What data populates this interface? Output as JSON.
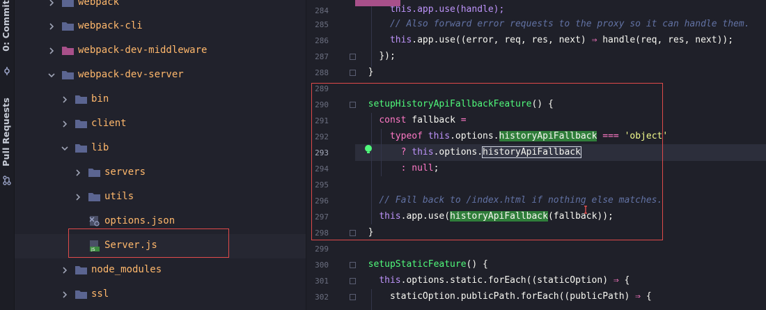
{
  "left_strip": {
    "commit_tab": "0: Commit",
    "pull_requests_tab": "Pull Requests"
  },
  "tree": {
    "items": [
      {
        "label": "webpack",
        "kind": "folder",
        "expanded": false,
        "color": "#ffb86c"
      },
      {
        "label": "webpack-cli",
        "kind": "folder",
        "expanded": false,
        "color": "#ffb86c"
      },
      {
        "label": "webpack-dev-middleware",
        "kind": "folder",
        "expanded": false,
        "color": "#ffb86c"
      },
      {
        "label": "webpack-dev-server",
        "kind": "folder",
        "expanded": true,
        "color": "#ffb86c"
      },
      {
        "label": "bin",
        "kind": "folder",
        "expanded": false,
        "color": "#ffb86c"
      },
      {
        "label": "client",
        "kind": "folder",
        "expanded": false,
        "color": "#ffb86c"
      },
      {
        "label": "lib",
        "kind": "folder",
        "expanded": true,
        "color": "#ffb86c"
      },
      {
        "label": "servers",
        "kind": "folder",
        "expanded": false,
        "color": "#ffb86c"
      },
      {
        "label": "utils",
        "kind": "folder",
        "expanded": false,
        "color": "#ffb86c"
      },
      {
        "label": "options.json",
        "kind": "json-file",
        "color": "#ffb86c"
      },
      {
        "label": "Server.js",
        "kind": "js-file",
        "selected": true,
        "color": "#ffb86c"
      },
      {
        "label": "node_modules",
        "kind": "folder",
        "expanded": false,
        "color": "#ffb86c"
      },
      {
        "label": "ssl",
        "kind": "folder",
        "expanded": false,
        "color": "#ffb86c"
      }
    ]
  },
  "editor": {
    "line_numbers": [
      "284",
      "285",
      "286",
      "287",
      "288",
      "289",
      "290",
      "291",
      "292",
      "293",
      "294",
      "295",
      "296",
      "297",
      "298",
      "299",
      "300",
      "301",
      "302"
    ],
    "current_line": "293",
    "lines": {
      "l284_a": "this.app.use(handle);",
      "l285_comment": "// Also forward error requests to the proxy so it can handle them.",
      "l286_this": "this",
      "l286_a": ".app.use((error, req, res, next) ",
      "l286_arrow": "⇒",
      "l286_b": " handle(req, res, next));",
      "l287": "});",
      "l288": "}",
      "l290_fn": "setupHistoryApiFallbackFeature",
      "l290_rest": "() {",
      "l291_kw": "const",
      "l291_a": " fallback ",
      "l291_op": "=",
      "l292_kw": "typeof",
      "l292_this": " this",
      "l292_a": ".options.",
      "l292_mark": "historyApiFallback",
      "l292_op": " === ",
      "l292_str": "'object'",
      "l293_op": "? ",
      "l293_this": "this",
      "l293_a": ".options.",
      "l293_mark": "historyApiFallback",
      "l294_op": ": ",
      "l294_kw": "null",
      "l294_end": ";",
      "l296_comment": "// Fall back to /index.html if nothing else matches.",
      "l297_this": "this",
      "l297_a": ".app.use(",
      "l297_mark": "historyApiFallback",
      "l297_b": "(fallback));",
      "l298": "}",
      "l300_fn": "setupStaticFeature",
      "l300_rest": "() {",
      "l301_this": "this",
      "l301_a": ".options.static.forEach((staticOption) ",
      "l301_arrow": "⇒",
      "l301_b": " {",
      "l302_a": "staticOption.publicPath.forEach((publicPath) ",
      "l302_arrow": "⇒",
      "l302_b": " {"
    }
  },
  "colors": {
    "highlight_box": "#e04a4a",
    "folder_icon": "#5b6591",
    "special_folder_icon": "#a8508a",
    "file_label": "#ffb86c",
    "match_highlight": "#2f7d3a"
  }
}
